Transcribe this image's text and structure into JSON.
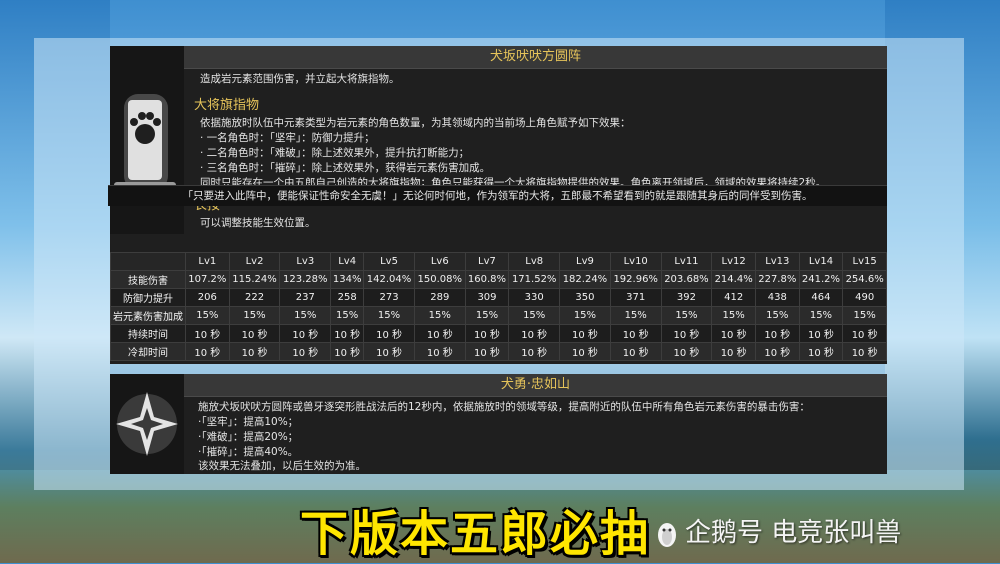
{
  "skill": {
    "title": "犬坂吠吠方圆阵",
    "desc": "造成岩元素范围伤害，并立起大将旗指物。",
    "section1_title": "大将旗指物",
    "lines": [
      "依据施放时队伍中元素类型为岩元素的角色数量，为其领域内的当前场上角色赋予如下效果：",
      "· 一名角色时：「坚牢」：防御力提升；",
      "· 二名角色时：「难破」：除上述效果外，提升抗打断能力；",
      "· 三名角色时：「摧碎」：除上述效果外，获得岩元素伤害加成。",
      "同时只能存在一个由五郎自己创造的大将旗指物；角色只能获得一个大将旗指物提供的效果。角色离开领域后，领域的效果将持续2秒。"
    ],
    "section2_title": "长按",
    "hold_desc": "可以调整技能生效位置。",
    "quote": "「只要进入此阵中，便能保证性命安全无虞！」无论何时何地，作为领军的大将，五郎最不希望看到的就是跟随其身后的同伴受到伤害。"
  },
  "table": {
    "levels": [
      "Lv1",
      "Lv2",
      "Lv3",
      "Lv4",
      "Lv5",
      "Lv6",
      "Lv7",
      "Lv8",
      "Lv9",
      "Lv10",
      "Lv11",
      "Lv12",
      "Lv13",
      "Lv14",
      "Lv15"
    ],
    "rows": [
      {
        "label": "技能伤害",
        "values": [
          "107.2%",
          "115.24%",
          "123.28%",
          "134%",
          "142.04%",
          "150.08%",
          "160.8%",
          "171.52%",
          "182.24%",
          "192.96%",
          "203.68%",
          "214.4%",
          "227.8%",
          "241.2%",
          "254.6%"
        ]
      },
      {
        "label": "防御力提升",
        "values": [
          "206",
          "222",
          "237",
          "258",
          "273",
          "289",
          "309",
          "330",
          "350",
          "371",
          "392",
          "412",
          "438",
          "464",
          "490"
        ]
      },
      {
        "label": "岩元素伤害加成",
        "values": [
          "15%",
          "15%",
          "15%",
          "15%",
          "15%",
          "15%",
          "15%",
          "15%",
          "15%",
          "15%",
          "15%",
          "15%",
          "15%",
          "15%",
          "15%"
        ]
      },
      {
        "label": "持续时间",
        "values": [
          "10 秒",
          "10 秒",
          "10 秒",
          "10 秒",
          "10 秒",
          "10 秒",
          "10 秒",
          "10 秒",
          "10 秒",
          "10 秒",
          "10 秒",
          "10 秒",
          "10 秒",
          "10 秒",
          "10 秒"
        ]
      },
      {
        "label": "冷却时间",
        "values": [
          "10 秒",
          "10 秒",
          "10 秒",
          "10 秒",
          "10 秒",
          "10 秒",
          "10 秒",
          "10 秒",
          "10 秒",
          "10 秒",
          "10 秒",
          "10 秒",
          "10 秒",
          "10 秒",
          "10 秒"
        ]
      }
    ]
  },
  "passive": {
    "title": "犬勇·忠如山",
    "lines": [
      "施放犬坂吠吠方圆阵或兽牙逐突形胜战法后的12秒内，依据施放时的领域等级，提高附近的队伍中所有角色岩元素伤害的暴击伤害：",
      "·「坚牢」：提高10%；",
      "·「难破」：提高20%；",
      "·「摧碎」：提高40%。",
      "该效果无法叠加，以后生效的为准。"
    ]
  },
  "caption": "下版本五郎必抽",
  "watermark": "企鹅号 电竞张叫兽",
  "colors": {
    "accent": "#e6c45a",
    "caption": "#ffe600"
  }
}
